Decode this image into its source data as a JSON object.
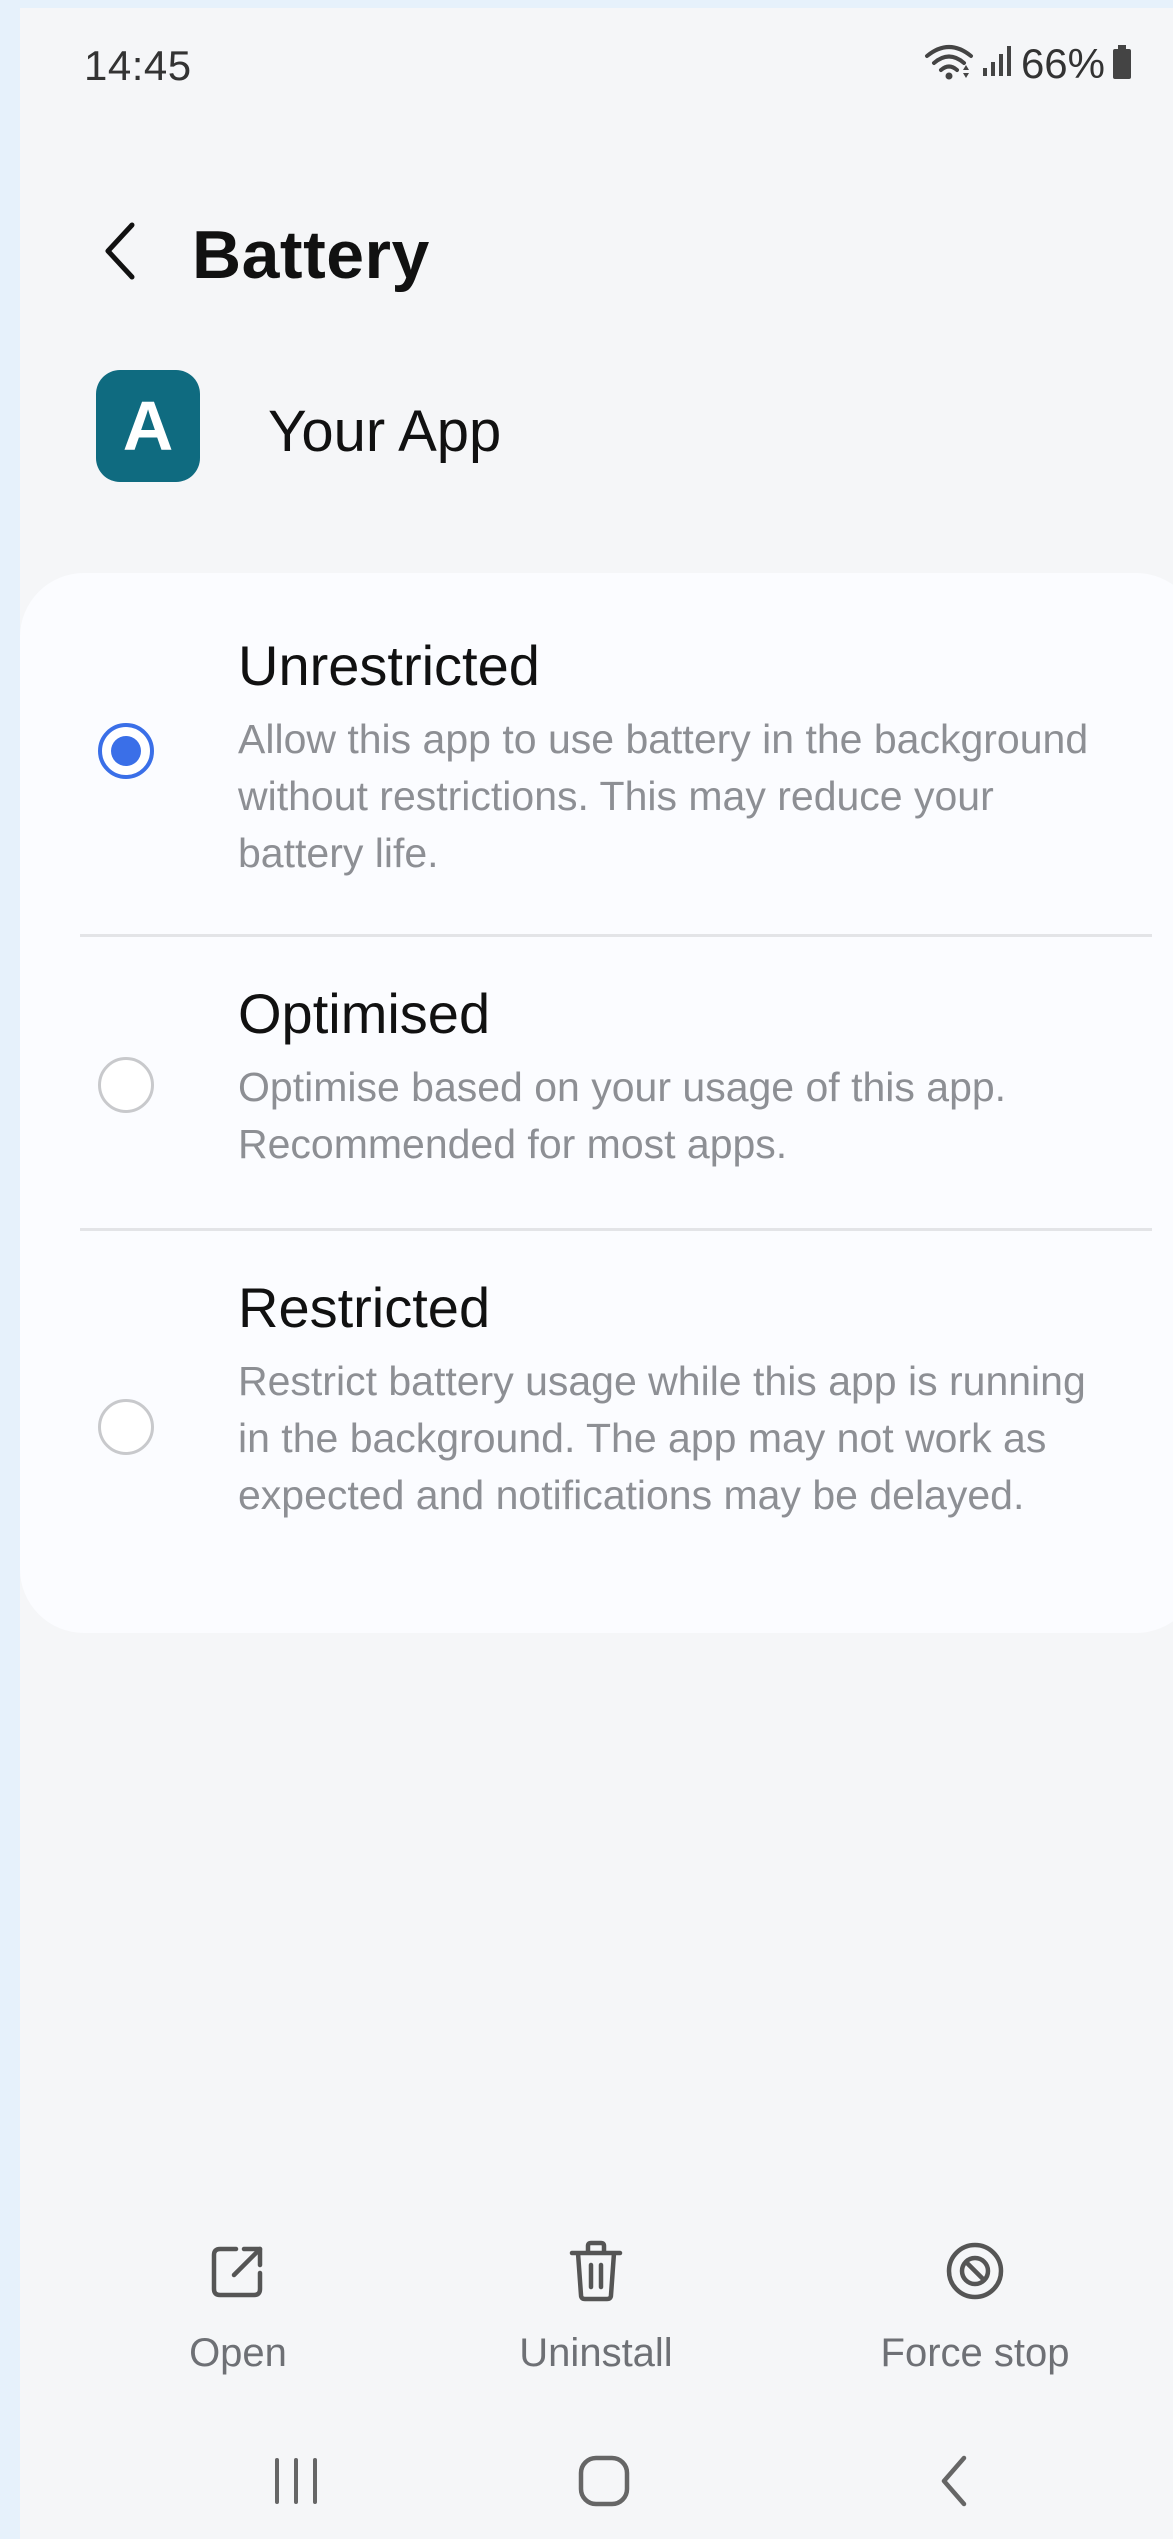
{
  "status_bar": {
    "time": "14:45",
    "battery_percent": "66%",
    "icons": [
      "wifi-icon",
      "signal-icon",
      "battery-icon"
    ]
  },
  "header": {
    "title": "Battery",
    "back_icon": "back-arrow-icon"
  },
  "app": {
    "icon_letter": "A",
    "name": "Your App",
    "icon_color": "#0f6b80"
  },
  "options": [
    {
      "title": "Unrestricted",
      "description": "Allow this app to use battery in the background without restrictions. This may reduce your battery life.",
      "selected": true
    },
    {
      "title": "Optimised",
      "description": "Optimise based on your usage of this app. Recommended for most apps.",
      "selected": false
    },
    {
      "title": "Restricted",
      "description": "Restrict battery usage while this app is running in the background. The app may not work as expected and notifications may be delayed.",
      "selected": false
    }
  ],
  "actions": [
    {
      "label": "Open",
      "icon": "open-external-icon"
    },
    {
      "label": "Uninstall",
      "icon": "trash-icon"
    },
    {
      "label": "Force stop",
      "icon": "stop-icon"
    }
  ],
  "nav_bar": {
    "icons": [
      "recents-icon",
      "home-icon",
      "back-icon"
    ]
  },
  "colors": {
    "accent": "#3a6fe8",
    "background": "#f5f6f8",
    "card": "#fbfcff",
    "secondary_text": "#8d8f94"
  }
}
